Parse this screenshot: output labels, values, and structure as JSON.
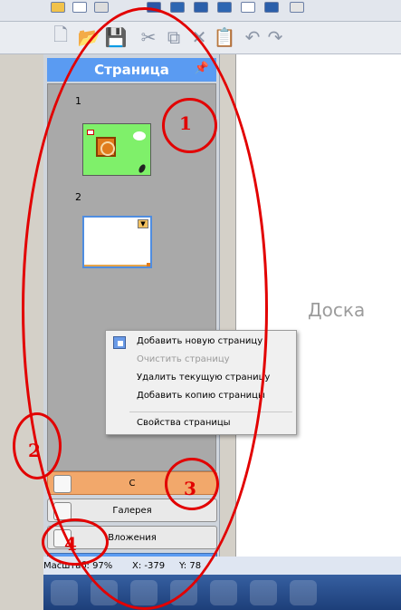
{
  "toolbar": {
    "new_page_icon": "new-page-icon",
    "open_icon": "open-icon",
    "save_icon": "save-icon",
    "cut_icon": "cut-icon",
    "copy_icon": "copy-icon",
    "delete_icon": "delete-icon",
    "paste_icon": "paste-icon",
    "undo_icon": "undo-icon",
    "redo_icon": "redo-icon"
  },
  "sidebar": {
    "title": "Страница",
    "pages": [
      {
        "number": "1"
      },
      {
        "number": "2"
      }
    ],
    "buttons": {
      "pages": "С",
      "gallery": "Галерея",
      "attachments": "Вложения"
    }
  },
  "context_menu": {
    "items": [
      "Добавить новую страницу",
      "Очистить страницу",
      "Удалить текущую страницу",
      "Добавить копию страницы",
      "Свойства страницы"
    ]
  },
  "board": {
    "label": "Доска"
  },
  "status": {
    "zoom": "Масштаб: 97%",
    "x": "X: -379",
    "y": "Y: 78"
  },
  "annotations": [
    "1",
    "2",
    "3",
    "4"
  ]
}
